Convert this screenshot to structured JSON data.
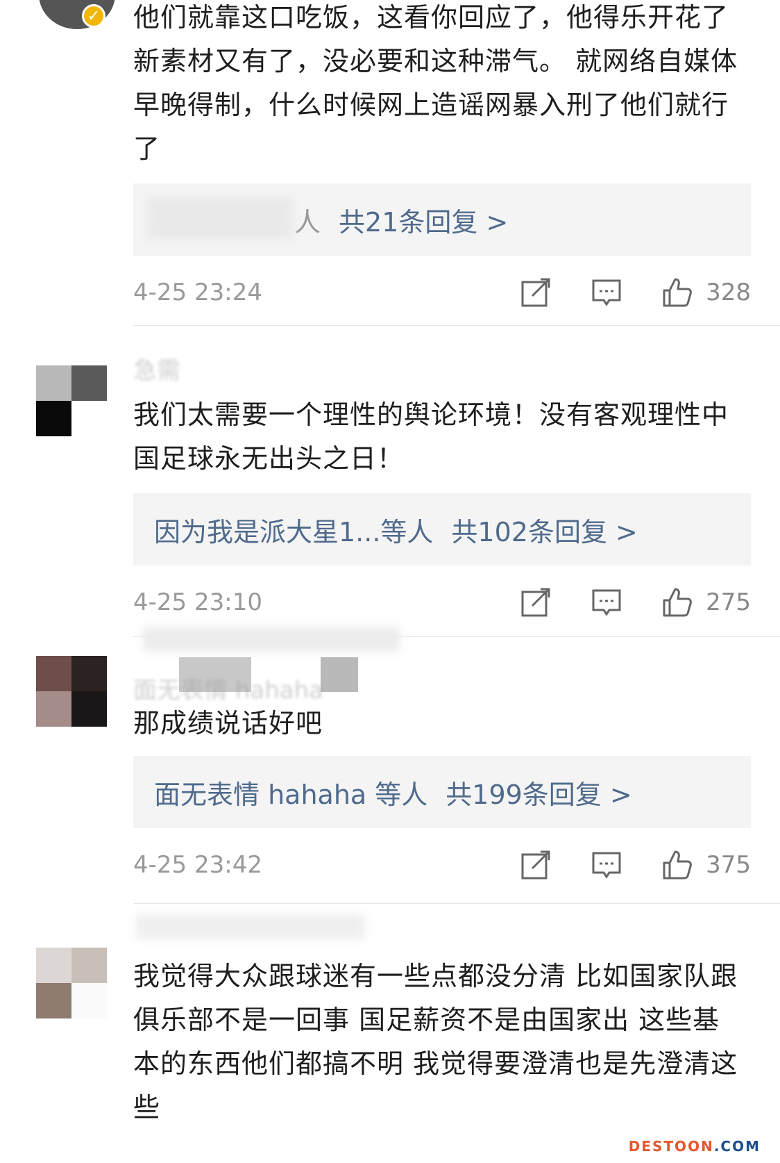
{
  "comments": [
    {
      "username": "",
      "text": "他们就靠这口吃饭，这看你回应了，他得乐开花了新素材又有了，没必要和这种滞气。 就网络自媒体早晚得制，什么时候网上造谣网暴入刑了他们就行了",
      "reply_names": "人",
      "reply_total": "共21条回复 >",
      "time": "4-25 23:24",
      "likes": "328"
    },
    {
      "username": "急需",
      "text": "我们太需要一个理性的舆论环境！没有客观理性中国足球永无出头之日！",
      "reply_names": "因为我是派大星1...等人",
      "reply_total": "共102条回复 >",
      "time": "4-25 23:10",
      "likes": "275"
    },
    {
      "username": "面无表情 hahaha",
      "text": "那成绩说话好吧",
      "reply_names": "面无表情 hahaha 等人",
      "reply_total": "共199条回复 >",
      "time": "4-25 23:42",
      "likes": "375"
    },
    {
      "username": "",
      "text": "我觉得大众跟球迷有一些点都没分清 比如国家队跟俱乐部不是一回事 国足薪资不是由国家出 这些基本的东西他们都搞不明 我觉得要澄清也是先澄清这些"
    }
  ],
  "icons": {
    "share": "share-icon",
    "comment": "comment-icon",
    "like": "thumbs-up-icon",
    "verified": "verified-badge-icon"
  },
  "colors": {
    "link": "#4f6a8c",
    "meta": "#999999",
    "verified": "#f2b705"
  },
  "watermark": {
    "part1": "DESTOON",
    "part2": ".COM"
  }
}
